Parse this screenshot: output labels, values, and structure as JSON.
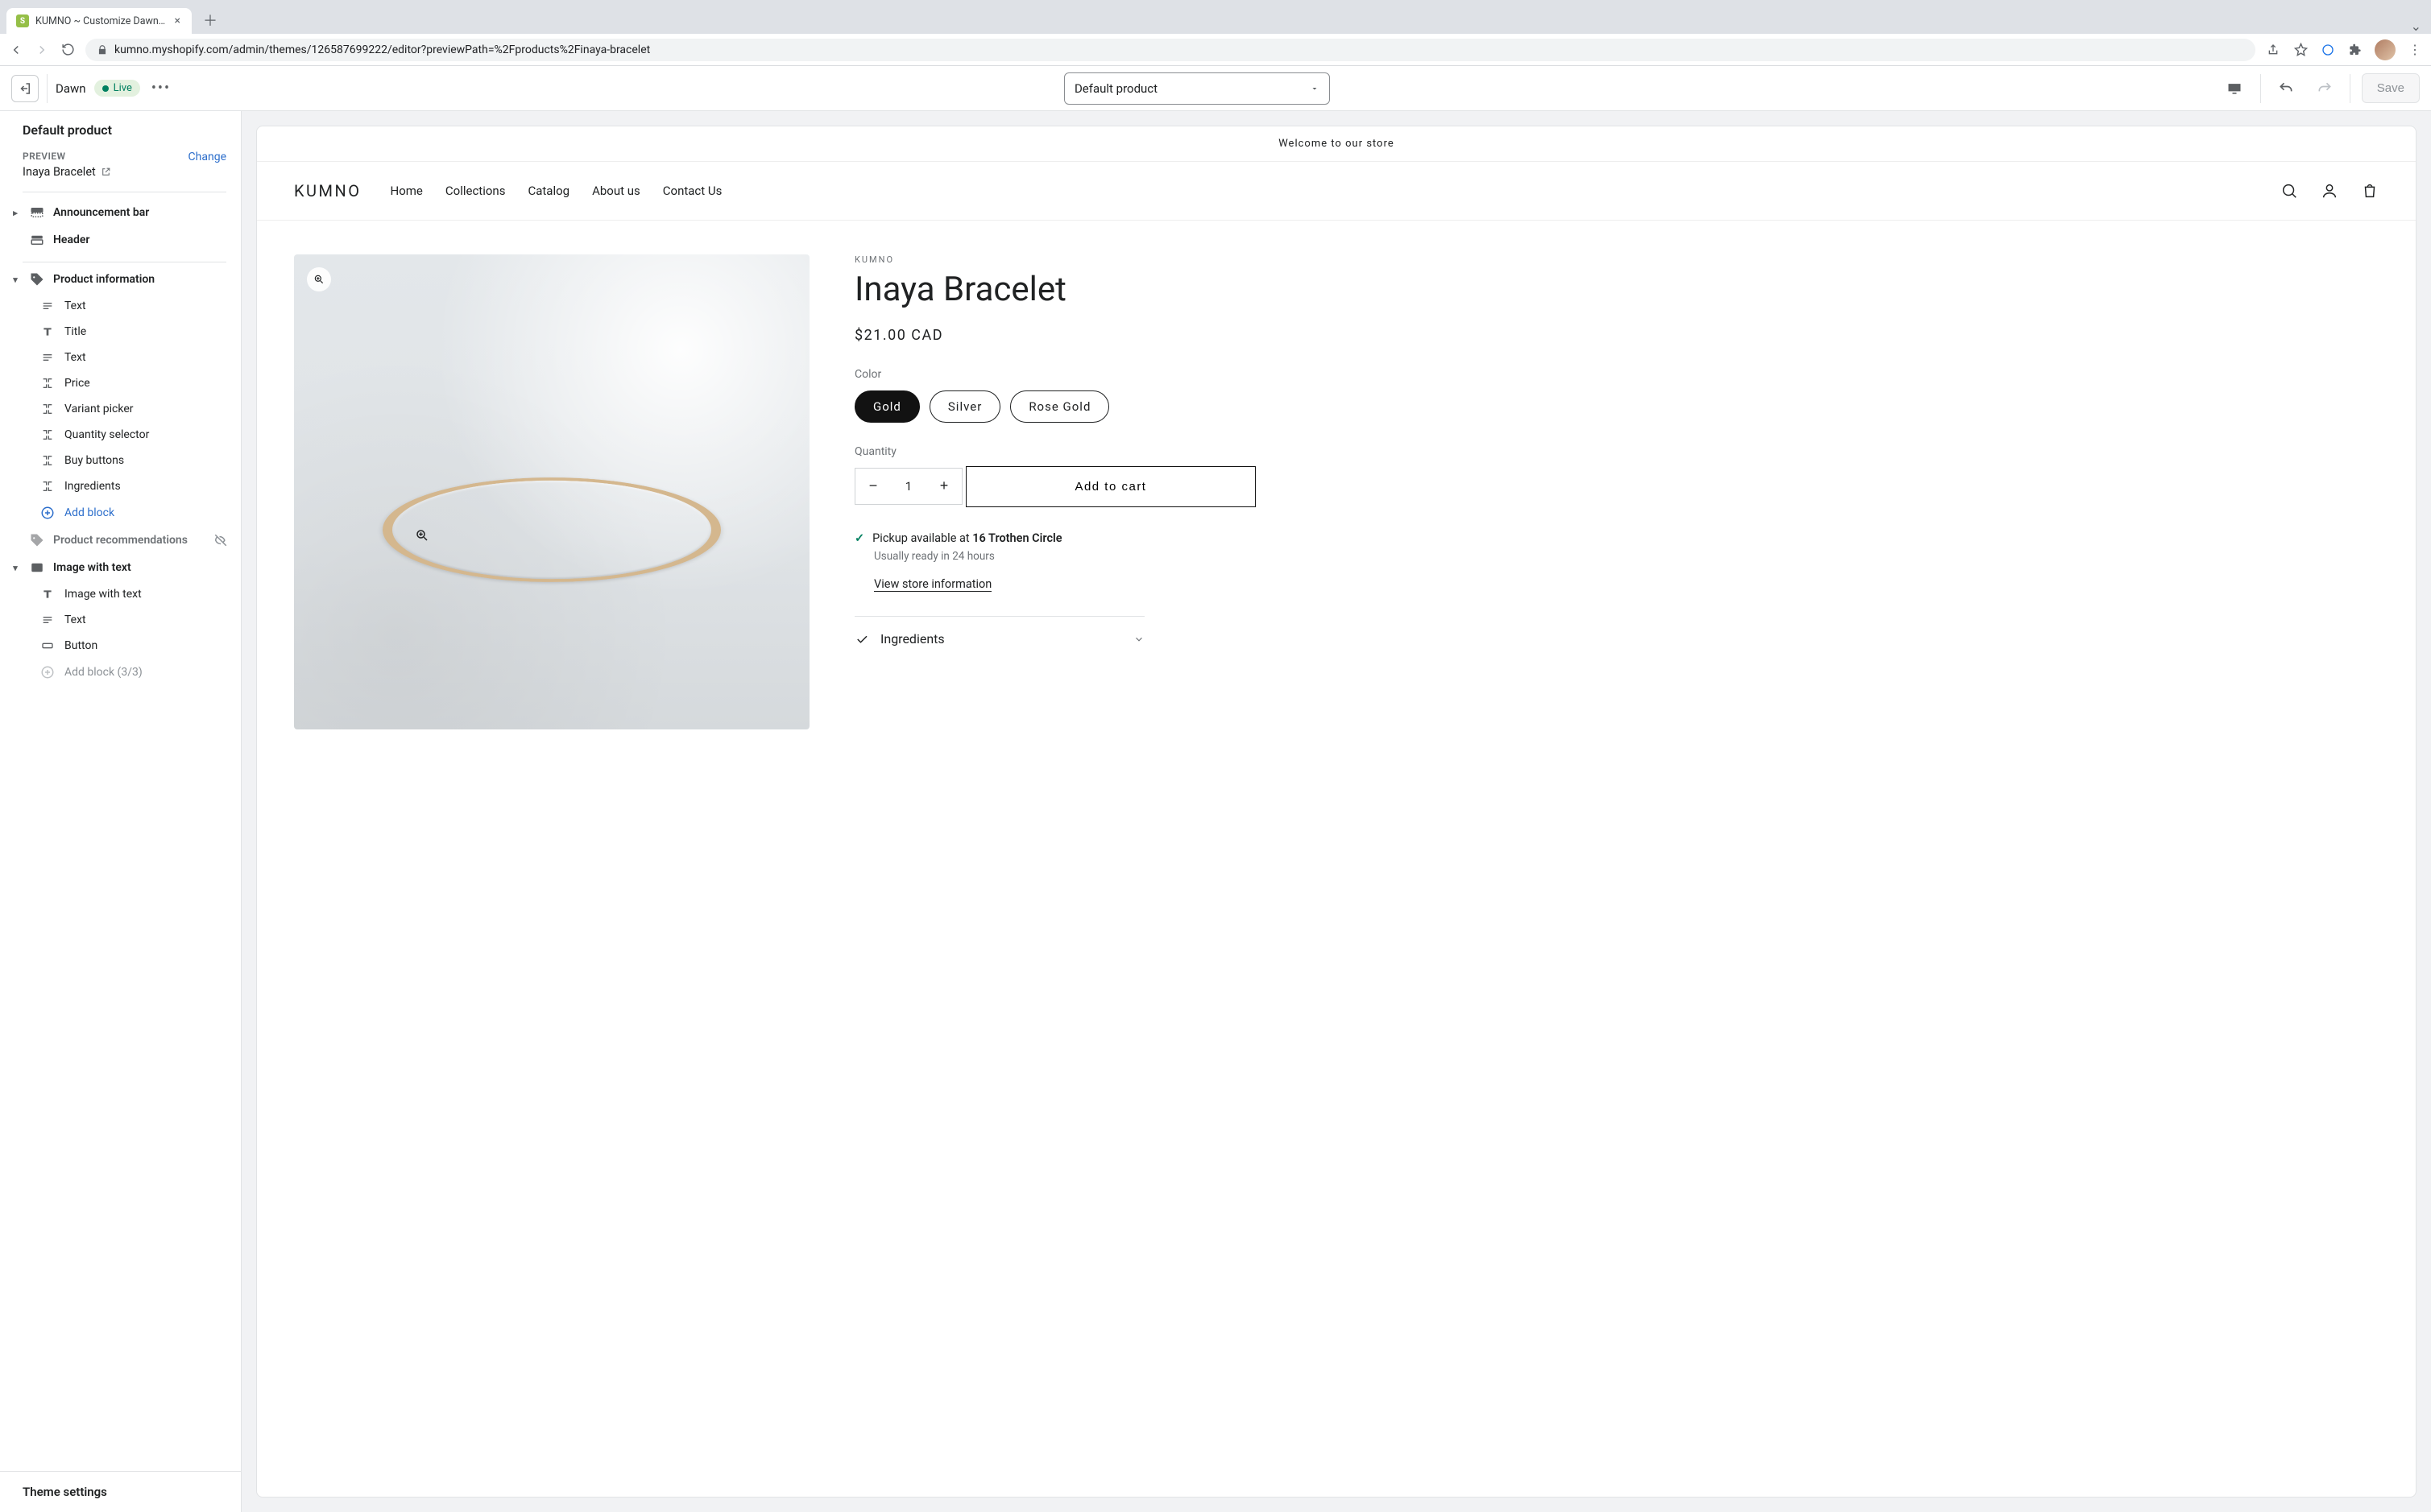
{
  "browser": {
    "tab_title": "KUMNO ~ Customize Dawn ~ S",
    "url": "kumno.myshopify.com/admin/themes/126587699222/editor?previewPath=%2Fproducts%2Finaya-bracelet"
  },
  "toolbar": {
    "theme_name": "Dawn",
    "status": "Live",
    "template_label": "Default product",
    "save_label": "Save"
  },
  "sidebar": {
    "title": "Default product",
    "preview_label": "PREVIEW",
    "change_label": "Change",
    "preview_item": "Inaya Bracelet",
    "sections": {
      "announcement": "Announcement bar",
      "header": "Header",
      "product_info": "Product information",
      "product_recs": "Product recommendations",
      "image_text": "Image with text"
    },
    "product_blocks": [
      "Text",
      "Title",
      "Text",
      "Price",
      "Variant picker",
      "Quantity selector",
      "Buy buttons",
      "Ingredients"
    ],
    "add_block": "Add block",
    "image_text_blocks": [
      "Image with text",
      "Text",
      "Button"
    ],
    "add_block_limited": "Add block (3/3)",
    "footer": "Theme settings"
  },
  "store": {
    "announcement": "Welcome to our store",
    "logo": "KUMNO",
    "nav": [
      "Home",
      "Collections",
      "Catalog",
      "About us",
      "Contact Us"
    ]
  },
  "product": {
    "vendor": "KUMNO",
    "title": "Inaya Bracelet",
    "price": "$21.00 CAD",
    "color_label": "Color",
    "variants": [
      "Gold",
      "Silver",
      "Rose Gold"
    ],
    "qty_label": "Quantity",
    "qty_value": "1",
    "add_to_cart": "Add to cart",
    "pickup_prefix": "Pickup available at ",
    "pickup_location": "16 Trothen Circle",
    "pickup_sub": "Usually ready in 24 hours",
    "store_info": "View store information",
    "accordion": "Ingredients"
  }
}
